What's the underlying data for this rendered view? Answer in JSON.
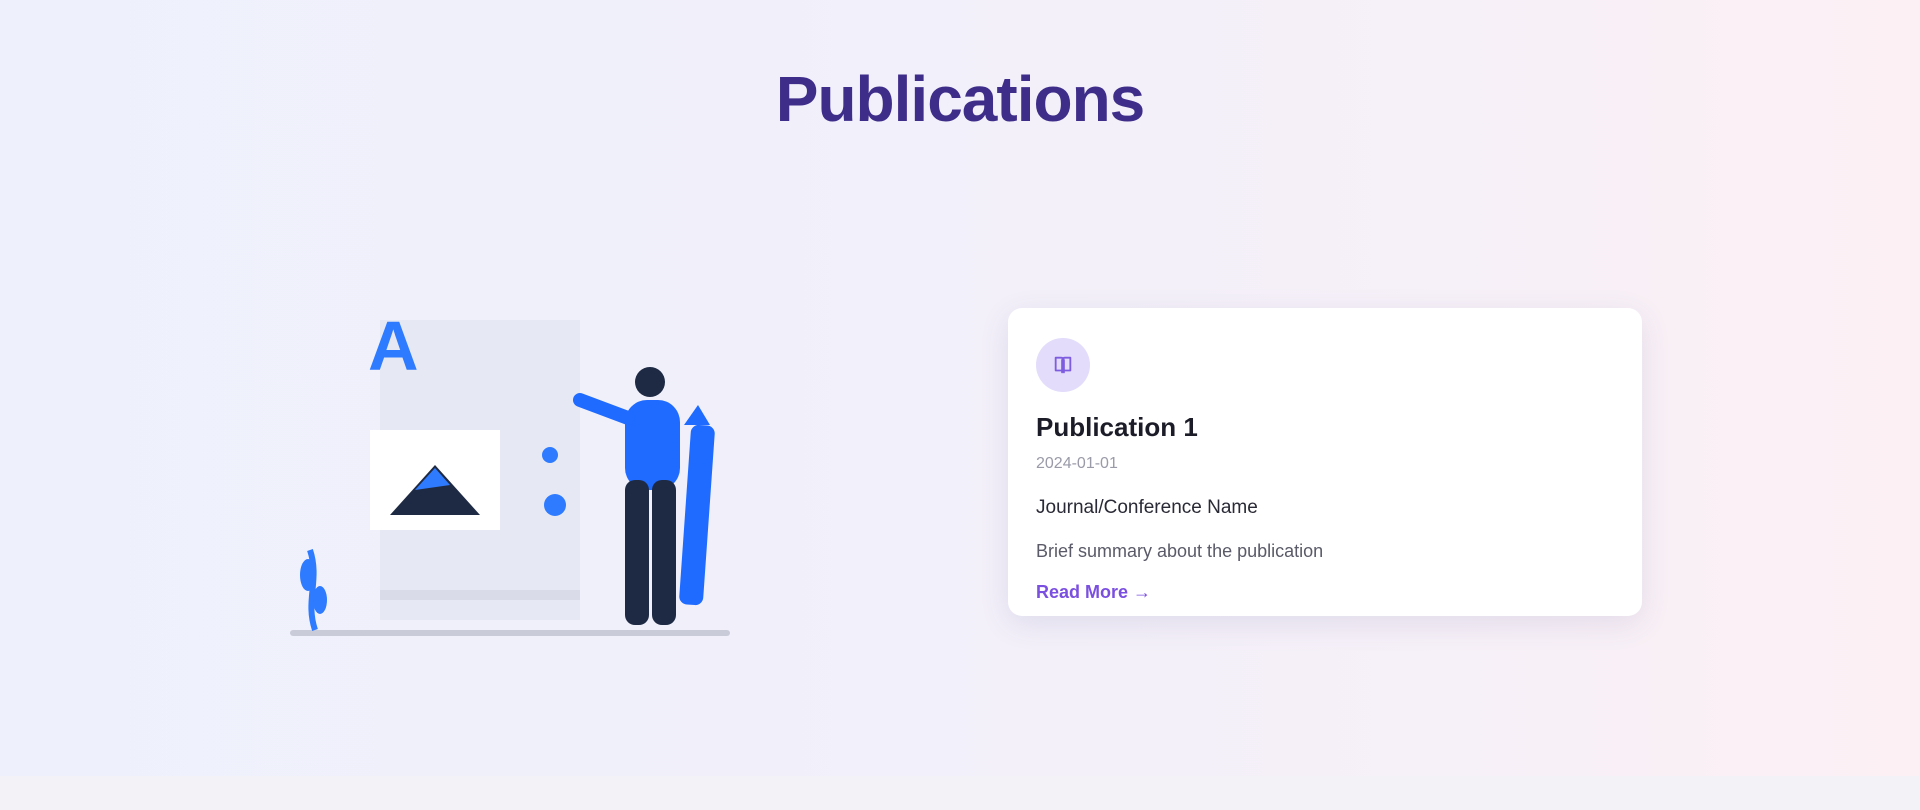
{
  "section": {
    "title": "Publications"
  },
  "publications": [
    {
      "title": "Publication 1",
      "date": "2024-01-01",
      "venue": "Journal/Conference Name",
      "summary": "Brief summary about the publication",
      "link_label": "Read More →",
      "icon": "book-icon"
    }
  ],
  "colors": {
    "title": "#3f2d8a",
    "accent": "#7b4fe0",
    "illustration_blue": "#1f6bff",
    "illustration_dark": "#1e2a44"
  }
}
